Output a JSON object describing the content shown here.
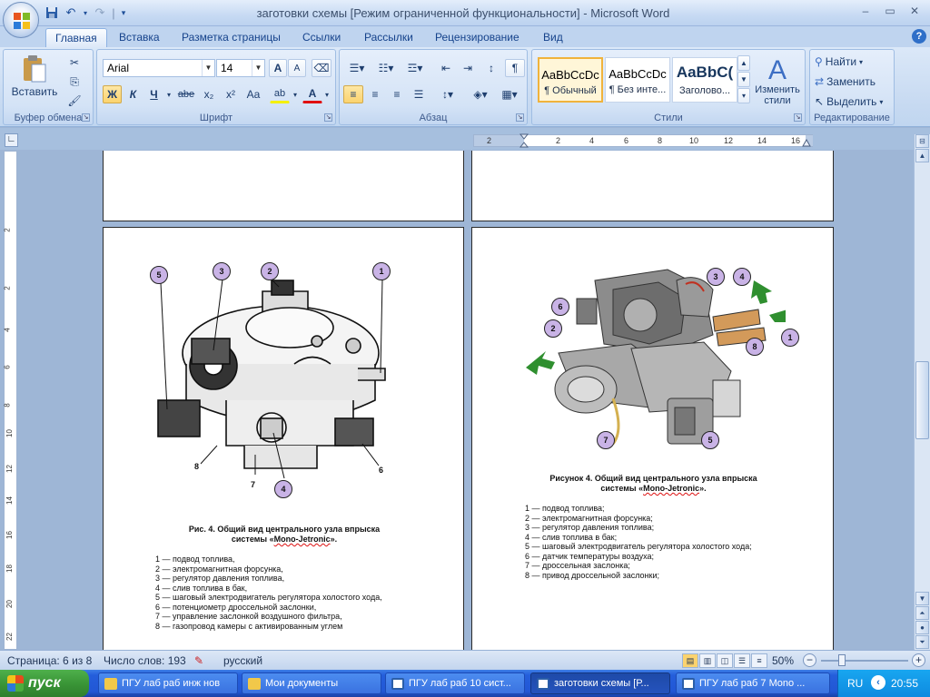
{
  "window": {
    "title": "заготовки схемы [Режим ограниченной функциональности] - Microsoft Word",
    "qat_separator": "|",
    "controls": [
      "–",
      "▭",
      "✕"
    ]
  },
  "tabs": [
    "Главная",
    "Вставка",
    "Разметка страницы",
    "Ссылки",
    "Рассылки",
    "Рецензирование",
    "Вид"
  ],
  "help_label": "?",
  "ribbon": {
    "clipboard": {
      "paste_label": "Вставить",
      "group_label": "Буфер обмена"
    },
    "font": {
      "font_name": "Arial",
      "font_size": "14",
      "grow": "A",
      "shrink": "A",
      "bold": "Ж",
      "italic": "К",
      "underline": "Ч",
      "strike": "abe",
      "subscript": "x₂",
      "superscript": "x²",
      "case": "Aa",
      "highlight": "ab",
      "color": "A",
      "group_label": "Шрифт"
    },
    "paragraph": {
      "group_label": "Абзац",
      "show_marks": "¶"
    },
    "styles": {
      "items": [
        {
          "sample": "AaBbCcDc",
          "name": "¶ Обычный"
        },
        {
          "sample": "AaBbCcDc",
          "name": "¶ Без инте..."
        },
        {
          "sample": "AaBbC(",
          "name": "Заголово..."
        }
      ],
      "change_label": "Изменить стили",
      "group_label": "Стили"
    },
    "editing": {
      "find": "Найти",
      "replace": "Заменить",
      "select": "Выделить",
      "group_label": "Редактирование"
    }
  },
  "hruler_numbers": [
    "2",
    "2",
    "4",
    "6",
    "8",
    "10",
    "12",
    "14",
    "16"
  ],
  "vruler_numbers": [
    "2",
    "2",
    "4",
    "6",
    "8",
    "10",
    "12",
    "14",
    "16",
    "18",
    "20",
    "22"
  ],
  "left_page": {
    "callouts": [
      "5",
      "3",
      "2",
      "1",
      "4"
    ],
    "plain_labels": [
      "8",
      "7",
      "6"
    ],
    "caption_line1": "Рис. 4. Общий вид центрального узла впрыска",
    "caption_line2_prefix": "системы «",
    "caption_line2_word": "Mono-Jetronic",
    "caption_line2_suffix": "».",
    "legend": [
      "1 — подвод топлива,",
      "2 — электромагнитная форсунка,",
      "3 — регулятор давления топлива,",
      "4 — слив топлива в бак,",
      "5 — шаговый электродвигатель регулятора холостого хода,",
      "6 — потенциометр дроссельной заслонки,",
      "7 — управление заслонкой воздушного фильтра,",
      "8 — газопровод камеры с активированным углем"
    ]
  },
  "right_page": {
    "callouts": [
      "3",
      "4",
      "6",
      "2",
      "8",
      "1",
      "7",
      "5"
    ],
    "caption_line1": "Рисунок 4. Общий вид центрального узла впрыска",
    "caption_line2_prefix": "системы «",
    "caption_line2_word": "Mono-Jetronic",
    "caption_line2_suffix": "».",
    "legend": [
      "1 — подвод топлива;",
      "2 — электромагнитная форсунка;",
      "3 — регулятор давления топлива;",
      "4 — слив топлива в бак;",
      "5 — шаговый электродвигатель регулятора холостого хода;",
      "6 — датчик температуры воздуха;",
      "7 — дроссельная заслонка;",
      "8 — привод дроссельной заслонки;"
    ]
  },
  "status": {
    "page": "Страница: 6 из 8",
    "words": "Число слов: 193",
    "language": "русский",
    "zoom": "50%",
    "zoom_minus": "−",
    "zoom_plus": "+"
  },
  "taskbar": {
    "start": "пуск",
    "tasks": [
      "ПГУ лаб раб инж нов",
      "Мои документы",
      "ПГУ лаб раб 10 сист...",
      "заготовки схемы [Р...",
      "ПГУ лаб раб 7 Mono ..."
    ],
    "lang": "RU",
    "clock": "20:55"
  },
  "colors": {
    "callout_fill": "#c9b3e6",
    "arrow_green": "#2f8f2f",
    "taskbar_blue": "#245edb",
    "start_green": "#3a9637"
  }
}
